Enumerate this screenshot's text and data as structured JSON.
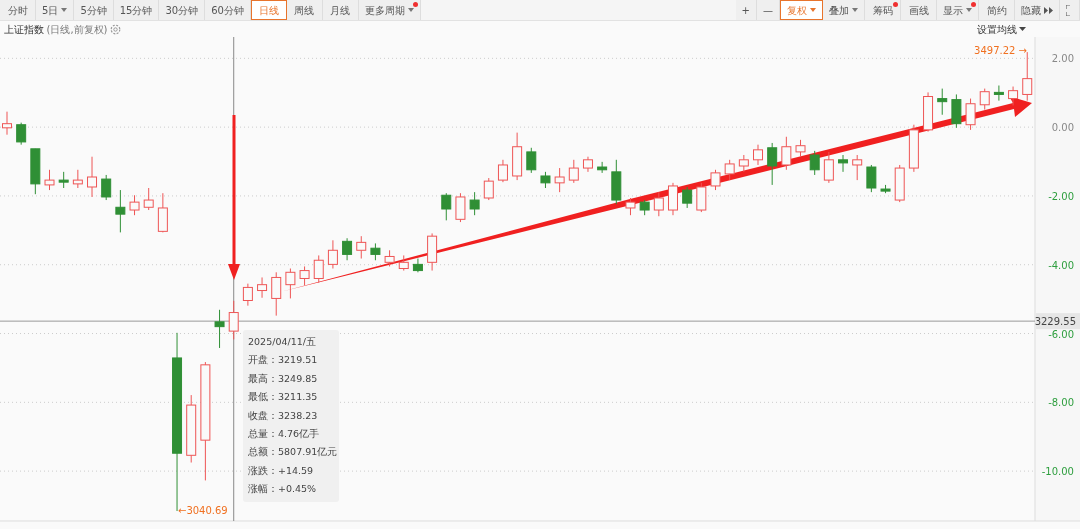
{
  "toolbar_left": [
    {
      "label": "分时",
      "selected": false,
      "dropdown": false,
      "badge": false
    },
    {
      "label": "5日",
      "selected": false,
      "dropdown": true,
      "badge": false
    },
    {
      "label": "5分钟",
      "selected": false,
      "dropdown": false,
      "badge": false
    },
    {
      "label": "15分钟",
      "selected": false,
      "dropdown": false,
      "badge": false
    },
    {
      "label": "30分钟",
      "selected": false,
      "dropdown": false,
      "badge": false
    },
    {
      "label": "60分钟",
      "selected": false,
      "dropdown": false,
      "badge": false
    },
    {
      "label": "日线",
      "selected": true,
      "dropdown": false,
      "badge": false
    },
    {
      "label": "周线",
      "selected": false,
      "dropdown": false,
      "badge": false
    },
    {
      "label": "月线",
      "selected": false,
      "dropdown": false,
      "badge": false
    },
    {
      "label": "更多周期",
      "selected": false,
      "dropdown": true,
      "badge": true
    }
  ],
  "toolbar_right": [
    {
      "label": "+",
      "selected": false,
      "dropdown": false,
      "badge": false
    },
    {
      "label": "—",
      "selected": false,
      "dropdown": false,
      "badge": false
    },
    {
      "label": "复权",
      "selected": true,
      "dropdown": true,
      "badge": false
    },
    {
      "label": "叠加",
      "selected": false,
      "dropdown": true,
      "badge": false
    },
    {
      "label": "筹码",
      "selected": false,
      "dropdown": false,
      "badge": true
    },
    {
      "label": "画线",
      "selected": false,
      "dropdown": false,
      "badge": false
    },
    {
      "label": "显示",
      "selected": false,
      "dropdown": true,
      "badge": true
    },
    {
      "label": "简约",
      "selected": false,
      "dropdown": false,
      "badge": false
    },
    {
      "label": "隐藏",
      "selected": false,
      "dropdown": false,
      "badge": false
    }
  ],
  "chart_header": {
    "title": "上证指数",
    "subtitle": "(日线,前复权)",
    "ma_settings": "设置均线"
  },
  "chart_data": {
    "type": "candlestick",
    "categories": [
      null,
      null,
      null,
      null,
      null,
      null,
      null,
      null,
      null,
      null,
      null,
      null,
      null,
      null,
      null,
      null,
      null,
      null,
      null,
      null,
      null,
      null,
      null,
      null,
      null,
      null,
      null,
      null,
      null,
      null,
      null,
      null,
      null,
      null,
      null,
      null,
      null,
      null,
      null,
      null,
      null,
      null,
      null,
      null,
      null,
      null,
      null,
      null,
      null,
      null,
      null,
      null,
      null,
      null,
      null,
      null,
      null,
      null,
      null,
      null,
      null,
      null,
      null,
      null,
      null,
      null,
      null,
      null,
      null,
      null,
      null,
      null,
      null
    ],
    "grid": true,
    "ohlc": [
      [
        -0.02,
        0.45,
        -0.22,
        0.1
      ],
      [
        0.07,
        0.13,
        -0.51,
        -0.43
      ],
      [
        -0.63,
        -0.63,
        -1.95,
        -1.65
      ],
      [
        -1.68,
        -1.24,
        -1.83,
        -1.54
      ],
      [
        -1.54,
        -1.3,
        -1.77,
        -1.6
      ],
      [
        -1.65,
        -1.24,
        -1.77,
        -1.54
      ],
      [
        -1.74,
        -0.86,
        -2.03,
        -1.45
      ],
      [
        -1.51,
        -1.39,
        -2.12,
        -2.03
      ],
      [
        -2.33,
        -1.83,
        -3.06,
        -2.53
      ],
      [
        -2.41,
        -1.98,
        -2.56,
        -2.18
      ],
      [
        -2.33,
        -1.77,
        -2.41,
        -2.12
      ],
      [
        -3.03,
        -1.92,
        -3.06,
        -2.35
      ],
      [
        -6.71,
        -5.98,
        -11.16,
        -9.48
      ],
      [
        -9.54,
        -7.79,
        -9.75,
        -8.08
      ],
      [
        -9.1,
        -6.83,
        -10.27,
        -6.91
      ],
      [
        -5.66,
        -5.31,
        -6.42,
        -5.8
      ],
      [
        -5.93,
        -5.05,
        -6.17,
        -5.39
      ],
      [
        -5.04,
        -4.55,
        -5.19,
        -4.66
      ],
      [
        -4.75,
        -4.37,
        -4.96,
        -4.58
      ],
      [
        -4.98,
        -4.22,
        -5.48,
        -4.37
      ],
      [
        -4.58,
        -4.11,
        -4.98,
        -4.22
      ],
      [
        -4.4,
        -4.05,
        -4.6,
        -4.17
      ],
      [
        -4.4,
        -3.73,
        -4.52,
        -3.87
      ],
      [
        -3.99,
        -3.29,
        -4.11,
        -3.58
      ],
      [
        -3.32,
        -3.23,
        -3.87,
        -3.7
      ],
      [
        -3.58,
        -3.17,
        -3.82,
        -3.35
      ],
      [
        -3.52,
        -3.38,
        -3.87,
        -3.7
      ],
      [
        -3.93,
        -3.58,
        -4.05,
        -3.76
      ],
      [
        -4.11,
        -3.73,
        -4.17,
        -3.93
      ],
      [
        -3.99,
        -3.82,
        -4.22,
        -4.17
      ],
      [
        -3.93,
        -3.09,
        -4.17,
        -3.17
      ],
      [
        -1.98,
        -1.92,
        -2.71,
        -2.38
      ],
      [
        -2.68,
        -1.92,
        -2.76,
        -2.03
      ],
      [
        -2.12,
        -1.89,
        -2.56,
        -2.38
      ],
      [
        -2.06,
        -1.48,
        -2.12,
        -1.57
      ],
      [
        -1.54,
        -0.95,
        -1.6,
        -1.1
      ],
      [
        -1.42,
        -0.16,
        -1.54,
        -0.57
      ],
      [
        -0.72,
        -0.6,
        -1.33,
        -1.24
      ],
      [
        -1.42,
        -1.3,
        -1.77,
        -1.62
      ],
      [
        -1.62,
        -1.19,
        -1.89,
        -1.45
      ],
      [
        -1.54,
        -0.95,
        -1.62,
        -1.19
      ],
      [
        -1.19,
        -0.86,
        -1.3,
        -0.95
      ],
      [
        -1.16,
        -1.01,
        -1.33,
        -1.24
      ],
      [
        -1.3,
        -0.95,
        -2.24,
        -2.12
      ],
      [
        -2.35,
        -2.06,
        -2.56,
        -2.18
      ],
      [
        -2.18,
        -2.12,
        -2.56,
        -2.41
      ],
      [
        -2.41,
        -1.89,
        -2.59,
        -2.06
      ],
      [
        -2.41,
        -1.62,
        -2.56,
        -1.71
      ],
      [
        -1.83,
        -1.74,
        -2.35,
        -2.21
      ],
      [
        -2.41,
        -1.62,
        -2.47,
        -1.74
      ],
      [
        -1.71,
        -1.24,
        -1.83,
        -1.33
      ],
      [
        -1.36,
        -0.95,
        -1.54,
        -1.07
      ],
      [
        -1.13,
        -0.81,
        -1.3,
        -0.95
      ],
      [
        -0.95,
        -0.51,
        -1.1,
        -0.66
      ],
      [
        -0.6,
        -0.46,
        -1.68,
        -1.13
      ],
      [
        -1.1,
        -0.28,
        -1.24,
        -0.57
      ],
      [
        -0.72,
        -0.37,
        -0.86,
        -0.54
      ],
      [
        -0.81,
        -0.69,
        -1.39,
        -1.24
      ],
      [
        -1.54,
        -0.72,
        -1.62,
        -0.95
      ],
      [
        -0.95,
        -0.81,
        -1.3,
        -1.04
      ],
      [
        -1.1,
        -0.81,
        -1.54,
        -0.95
      ],
      [
        -1.16,
        -1.1,
        -1.89,
        -1.77
      ],
      [
        -1.8,
        -1.68,
        -1.92,
        -1.86
      ],
      [
        -2.12,
        -1.1,
        -2.18,
        -1.19
      ],
      [
        -1.19,
        0.07,
        -1.3,
        -0.08
      ],
      [
        -0.08,
        1.01,
        -0.13,
        0.89
      ],
      [
        0.83,
        1.12,
        0.36,
        0.74
      ],
      [
        0.8,
        0.95,
        -0.02,
        0.1
      ],
      [
        0.07,
        0.83,
        -0.08,
        0.68
      ],
      [
        0.65,
        1.12,
        0.51,
        1.03
      ],
      [
        1.01,
        1.21,
        0.77,
        0.95
      ],
      [
        0.83,
        1.18,
        0.63,
        1.06
      ],
      [
        0.95,
        2.18,
        0.77,
        1.41
      ]
    ],
    "ylim": [
      -11.45,
      2.62
    ],
    "ref_lines": [
      {
        "axis": "y",
        "value": -5.64
      }
    ],
    "yticks": [
      {
        "value": 2,
        "label": "2.00"
      },
      {
        "value": 0,
        "label": "0.00"
      },
      {
        "value": -2,
        "label": "-2.00"
      },
      {
        "value": -4,
        "label": "-4.00"
      },
      {
        "value": -6,
        "label": "-6.00"
      },
      {
        "value": -8,
        "label": "-8.00"
      },
      {
        "value": -10,
        "label": "-10.00"
      }
    ]
  },
  "crosshair_value": "3229.55",
  "high_marker": "3497.22 →",
  "low_marker": "←3040.69",
  "tooltip": {
    "date": "2025/04/11/五",
    "rows": [
      "开盘：3219.51",
      "最高：3249.85",
      "最低：3211.35",
      "收盘：3238.23",
      "总量：4.76亿手",
      "总额：5807.91亿元",
      "涨跌：+14.59",
      "涨幅：+0.45%"
    ]
  }
}
